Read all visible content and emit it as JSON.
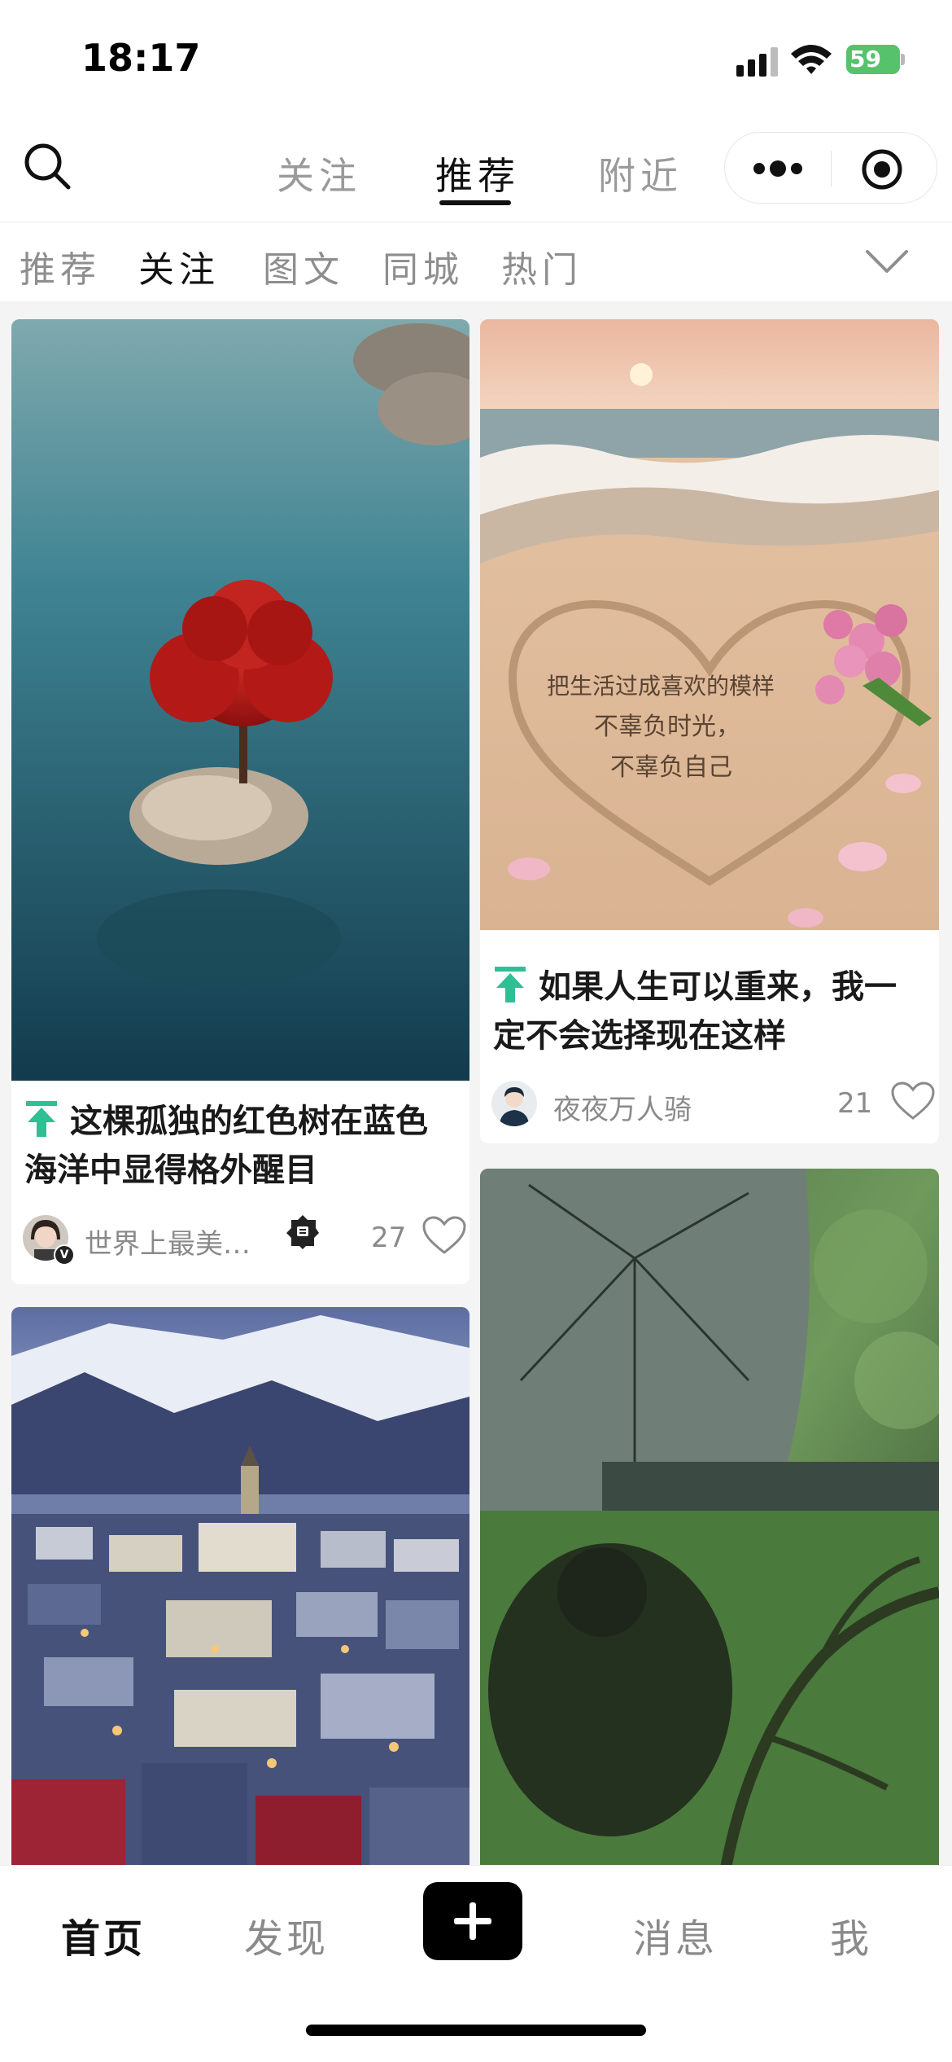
{
  "status_bar": {
    "time": "18:17",
    "battery": "59"
  },
  "top_nav": {
    "tabs": [
      {
        "label": "关注",
        "active": false
      },
      {
        "label": "推荐",
        "active": true
      },
      {
        "label": "附近",
        "active": false
      }
    ]
  },
  "sub_nav": {
    "tabs": [
      {
        "label": "推荐",
        "active": false
      },
      {
        "label": "关注",
        "active": true
      },
      {
        "label": "图文",
        "active": false
      },
      {
        "label": "同城",
        "active": false
      },
      {
        "label": "热门",
        "active": false
      }
    ]
  },
  "feed": {
    "posts": [
      {
        "title_line1": "这棵孤独的红色树在蓝色",
        "title_line2": "海洋中显得格外醒目",
        "author": "世界上最美…",
        "likes": "27",
        "pinned": true,
        "image": "red tree on rock in blue sea"
      },
      {
        "title_line1": "如果人生可以重来，我一",
        "title_line2": "定不会选择现在这样",
        "author": "夜夜万人骑",
        "likes": "21",
        "pinned": true,
        "image": "sand heart with text on beach, roses",
        "image_text": [
          "把生活过成喜欢的模样",
          "不辜负时光，",
          "不辜负自己"
        ]
      },
      {
        "image": "snowy mountains over town at dusk"
      },
      {
        "image": "umbrella under green tree canopy"
      }
    ]
  },
  "bottom_bar": {
    "items": [
      {
        "label": "首页",
        "active": true
      },
      {
        "label": "发现",
        "active": false
      },
      {
        "label": "消息",
        "active": false
      },
      {
        "label": "我",
        "active": false
      }
    ]
  },
  "colors": {
    "accent": "#2fbf95",
    "text": "#1a1a1a",
    "muted": "#8a8a8a",
    "battery": "#57c26c"
  }
}
